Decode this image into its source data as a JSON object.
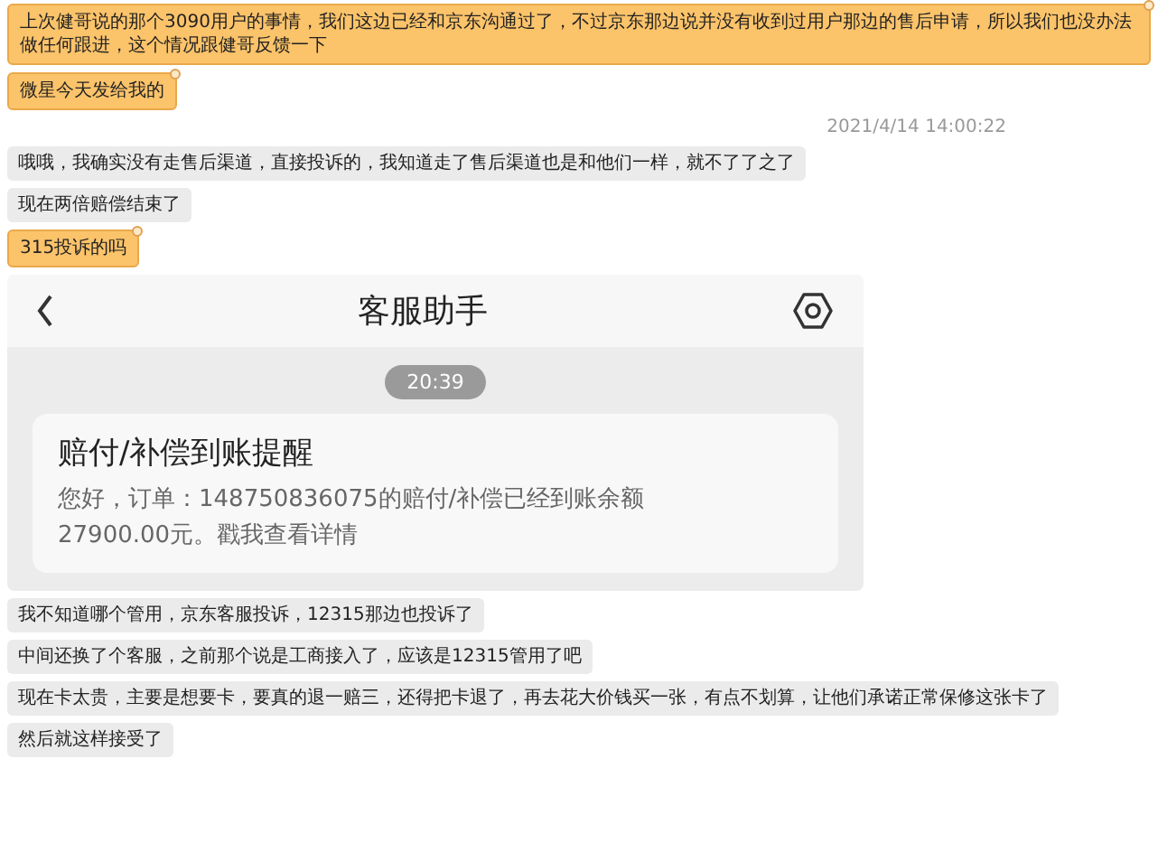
{
  "messages": [
    {
      "kind": "sent",
      "text": "上次健哥说的那个3090用户的事情，我们这边已经和京东沟通过了，不过京东那边说并没有收到过用户那边的售后申请，所以我们也没办法做任何跟进，这个情况跟健哥反馈一下"
    },
    {
      "kind": "sent",
      "text": "微星今天发给我的"
    },
    {
      "kind": "timestamp",
      "text": "2021/4/14 14:00:22"
    },
    {
      "kind": "received",
      "text": "哦哦，我确实没有走售后渠道，直接投诉的，我知道走了售后渠道也是和他们一样，就不了了之了"
    },
    {
      "kind": "received",
      "text": "现在两倍赔偿结束了"
    },
    {
      "kind": "sent",
      "text": "315投诉的吗"
    },
    {
      "kind": "screenshot",
      "app": {
        "title": "客服助手",
        "time": "20:39",
        "card": {
          "title": "赔付/补偿到账提醒",
          "body": "您好，订单：148750836075的赔付/补偿已经到账余额27900.00元。戳我查看详情"
        }
      }
    },
    {
      "kind": "received",
      "text": "我不知道哪个管用，京东客服投诉，12315那边也投诉了"
    },
    {
      "kind": "received",
      "text": "中间还换了个客服，之前那个说是工商接入了，应该是12315管用了吧"
    },
    {
      "kind": "received",
      "text": "现在卡太贵，主要是想要卡，要真的退一赔三，还得把卡退了，再去花大价钱买一张，有点不划算，让他们承诺正常保修这张卡了"
    },
    {
      "kind": "received",
      "text": "然后就这样接受了"
    }
  ]
}
